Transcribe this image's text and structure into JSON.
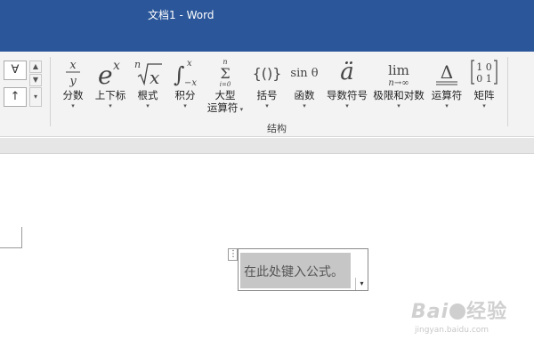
{
  "window": {
    "title": "文档1 - Word"
  },
  "symbols": {
    "items": [
      "∀",
      "↑"
    ],
    "scroll_up": "▲",
    "scroll_down": "▼",
    "more": "▾"
  },
  "ribbon": {
    "group_label": "结构",
    "tools": [
      {
        "id": "fraction",
        "label": "分数",
        "label2": "",
        "icon": "fraction-icon",
        "glyph": "x/y"
      },
      {
        "id": "script",
        "label": "上下标",
        "label2": "",
        "icon": "superscript-icon",
        "glyph": "eˣ"
      },
      {
        "id": "radical",
        "label": "根式",
        "label2": "",
        "icon": "radical-icon",
        "glyph": "ⁿ√x"
      },
      {
        "id": "integral",
        "label": "积分",
        "label2": "",
        "icon": "integral-icon",
        "glyph": "∫"
      },
      {
        "id": "large_operator",
        "label": "大型",
        "label2": "运算符",
        "icon": "sigma-icon",
        "glyph": "Σ"
      },
      {
        "id": "bracket",
        "label": "括号",
        "label2": "",
        "icon": "bracket-icon",
        "glyph": "{()}"
      },
      {
        "id": "function",
        "label": "函数",
        "label2": "",
        "icon": "function-icon",
        "glyph": "sin θ"
      },
      {
        "id": "accent",
        "label": "导数符号",
        "label2": "",
        "icon": "accent-icon",
        "glyph": "ä"
      },
      {
        "id": "limit_log",
        "label": "极限和对数",
        "label2": "",
        "icon": "limit-icon",
        "glyph": "lim"
      },
      {
        "id": "operator",
        "label": "运算符",
        "label2": "",
        "icon": "operator-icon",
        "glyph": "Δ"
      },
      {
        "id": "matrix",
        "label": "矩阵",
        "label2": "",
        "icon": "matrix-icon",
        "glyph": "[10 01]"
      }
    ]
  },
  "equation": {
    "placeholder": "在此处键入公式。",
    "handle": "⋮",
    "dropdown": "▾"
  },
  "watermark": {
    "brand": "Bai",
    "brand_suffix": "经验",
    "url": "jingyan.baidu.com"
  }
}
